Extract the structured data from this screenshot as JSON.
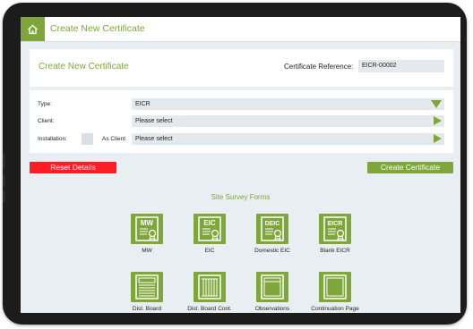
{
  "header": {
    "title": "Create New Certificate",
    "home_icon": "home-icon"
  },
  "certificate": {
    "heading": "Create New Certificate",
    "reference_label": "Certificate Reference:",
    "reference_value": "EICR-00002"
  },
  "fields": {
    "type_label": "Type:",
    "type_value": "EICR",
    "client_label": "Client:",
    "client_value": "Please select",
    "installation_label": "Installation:",
    "as_client_label": "As Client",
    "installation_value": "Please select"
  },
  "actions": {
    "reset_label": "Reset Details",
    "create_label": "Create Certificate"
  },
  "forms": {
    "section_title": "Site Survey Forms",
    "items": [
      {
        "label": "MW",
        "badge": "MW"
      },
      {
        "label": "EIC",
        "badge": "EIC"
      },
      {
        "label": "Domestic EIC",
        "badge": "DEIC"
      },
      {
        "label": "Blank EICR",
        "badge": "EICR"
      },
      {
        "label": "Dist. Board"
      },
      {
        "label": "Dist. Board Cont."
      },
      {
        "label": "Observations"
      },
      {
        "label": "Continuation Page"
      }
    ]
  },
  "colors": {
    "accent": "#7fa63a",
    "danger": "#ff1d25",
    "background": "#e9eef2"
  }
}
